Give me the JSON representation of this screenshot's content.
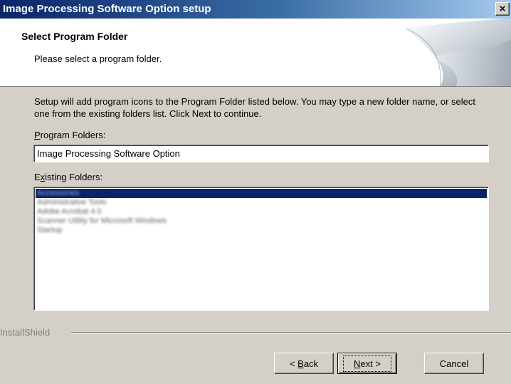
{
  "window": {
    "title": "Image Processing Software Option setup",
    "close_label": "×"
  },
  "header": {
    "title": "Select Program Folder",
    "subtitle": "Please select a program folder."
  },
  "body": {
    "description": "Setup will add program icons to the Program Folder listed below.  You may type a new folder name, or select one from the existing folders list.  Click Next to continue.",
    "program_folders_label": {
      "accel": "P",
      "rest": "rogram Folders:"
    },
    "program_folder_value": "Image Processing Software Option",
    "existing_folders_label": {
      "pre": "E",
      "accel": "x",
      "rest": "isting Folders:"
    },
    "existing_folders": [
      {
        "label": "Accessories",
        "selected": true
      },
      {
        "label": "Administrative Tools",
        "selected": false
      },
      {
        "label": "Adobe Acrobat 4.0",
        "selected": false
      },
      {
        "label": "Scanner Utility for Microsoft Windows",
        "selected": false
      },
      {
        "label": "Startup",
        "selected": false
      }
    ]
  },
  "footer": {
    "brand": "InstallShield",
    "back_button": {
      "pre": "< ",
      "accel": "B",
      "rest": "ack"
    },
    "next_button": {
      "accel": "N",
      "rest": "ext >"
    },
    "cancel_button": "Cancel"
  },
  "colors": {
    "title_gradient_start": "#0a246a",
    "title_gradient_end": "#a6caf0",
    "selection": "#0a246a",
    "dialog_face": "#d4d0c8"
  }
}
